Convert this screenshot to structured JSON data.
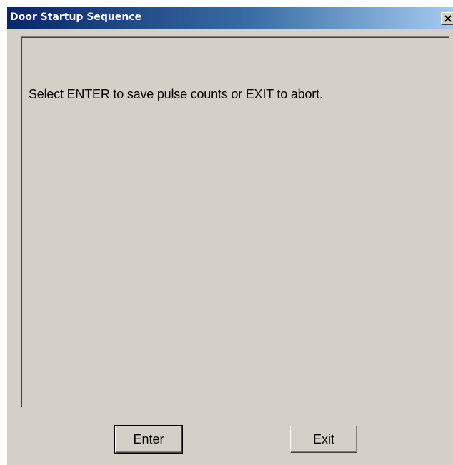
{
  "window": {
    "title": "Door Startup Sequence",
    "close_glyph": "close-icon"
  },
  "content": {
    "message": "Select ENTER to save pulse counts or EXIT to abort."
  },
  "buttons": {
    "enter_label": "Enter",
    "exit_label": "Exit"
  },
  "colors": {
    "titlebar_start": "#0a246a",
    "titlebar_end": "#a6caf0",
    "face": "#d4d0c8"
  }
}
